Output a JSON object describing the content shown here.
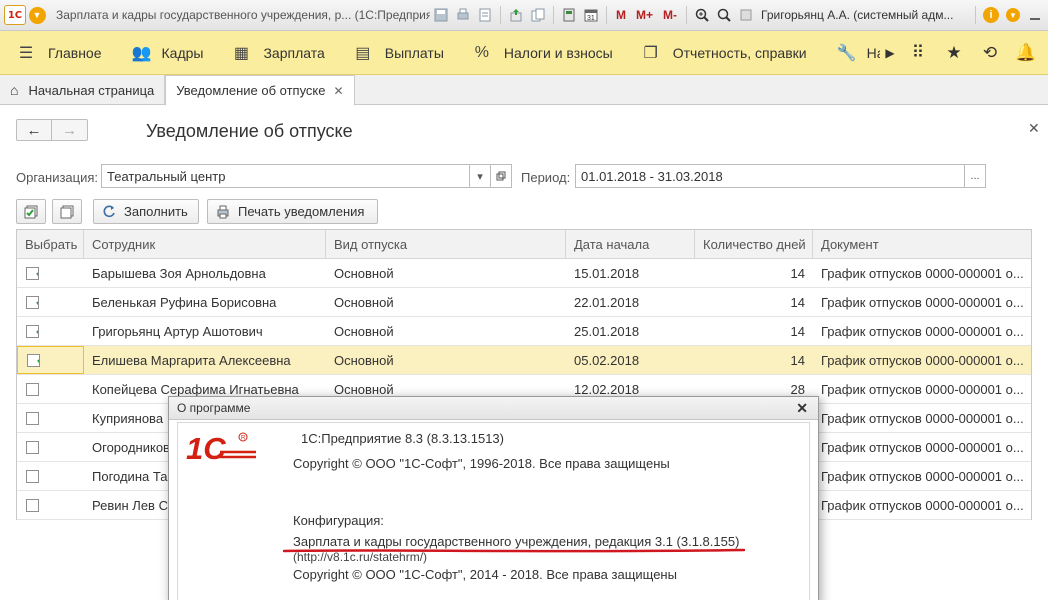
{
  "titlebar": {
    "app_logo": "1С",
    "window_title": "Зарплата и кадры государственного учреждения, р... (1С:Предприятие)",
    "mplus": "M",
    "mplus2": "M+",
    "mminus": "M-",
    "user": "Григорьянц А.А. (системный адм...",
    "icons": [
      "save-icon",
      "print-icon",
      "preview-icon",
      "link-icon",
      "calculator-icon",
      "calendar-icon",
      "zoom-icon",
      "search-icon",
      "info-icon",
      "minimize-icon"
    ]
  },
  "sections": [
    {
      "label": "Главное",
      "icon": "menu-icon"
    },
    {
      "label": "Кадры",
      "icon": "people-icon"
    },
    {
      "label": "Зарплата",
      "icon": "calculator-icon"
    },
    {
      "label": "Выплаты",
      "icon": "wallet-icon"
    },
    {
      "label": "Налоги и взносы",
      "icon": "percent-icon"
    },
    {
      "label": "Отчетность, справки",
      "icon": "report-icon"
    },
    {
      "label": "Настрой",
      "icon": "wrench-icon"
    }
  ],
  "tabs": [
    {
      "label": "Начальная страница"
    },
    {
      "label": "Уведомление об отпуске"
    }
  ],
  "form": {
    "title": "Уведомление об отпуске",
    "org_label": "Организация:",
    "org_value": "Театральный центр",
    "period_label": "Период:",
    "period_value": "01.01.2018 - 31.03.2018",
    "period_btn": "...",
    "fill_btn": "Заполнить",
    "print_btn": "Печать уведомления"
  },
  "table": {
    "columns": [
      "Выбрать",
      "Сотрудник",
      "Вид отпуска",
      "Дата начала",
      "Количество дней",
      "Документ"
    ],
    "rows": [
      {
        "checked": true,
        "employee": "Барышева Зоя Арнольдовна",
        "type": "Основной",
        "start": "15.01.2018",
        "days": "14",
        "doc": "График отпусков 0000-000001 о..."
      },
      {
        "checked": true,
        "employee": "Беленькая Руфина Борисовна",
        "type": "Основной",
        "start": "22.01.2018",
        "days": "14",
        "doc": "График отпусков 0000-000001 о..."
      },
      {
        "checked": true,
        "employee": "Григорьянц Артур Ашотович",
        "type": "Основной",
        "start": "25.01.2018",
        "days": "14",
        "doc": "График отпусков 0000-000001 о..."
      },
      {
        "checked": true,
        "employee": "Елишева Маргарита Алексеевна",
        "type": "Основной",
        "start": "05.02.2018",
        "days": "14",
        "doc": "График отпусков 0000-000001 о..."
      },
      {
        "checked": false,
        "employee": "Копейцева Серафима Игнатьевна",
        "type": "Основной",
        "start": "12.02.2018",
        "days": "28",
        "doc": "График отпусков 0000-000001 о..."
      },
      {
        "checked": false,
        "employee": "Куприянова",
        "type": "",
        "start": "",
        "days": "",
        "doc": "График отпусков 0000-000001 о..."
      },
      {
        "checked": false,
        "employee": "Огородников",
        "type": "",
        "start": "",
        "days": "",
        "doc": "График отпусков 0000-000001 о..."
      },
      {
        "checked": false,
        "employee": "Погодина Та",
        "type": "",
        "start": "",
        "days": "",
        "doc": "График отпусков 0000-000001 о..."
      },
      {
        "checked": false,
        "employee": "Ревин Лев С",
        "type": "",
        "start": "",
        "days": "",
        "doc": "График отпусков 0000-000001 о..."
      }
    ]
  },
  "about": {
    "title": "О программе",
    "logo_text": "1С",
    "platform": "1С:Предприятие 8.3 (8.3.13.1513)",
    "copyright1": "Copyright © ООО \"1С-Софт\", 1996-2018. Все права защищены",
    "config_label": "Конфигурация:",
    "config_name": "Зарплата и кадры государственного учреждения, редакция 3.1 (3.1.8.155)",
    "config_url": "(http://v8.1c.ru/statehrm/)",
    "copyright2": "Copyright © ООО \"1С-Софт\", 2014 - 2018. Все права защищены"
  },
  "colors": {
    "accent_bar": "#fbed9e",
    "selected_row": "#fbf0c0",
    "underline": "#d0161e",
    "logo_red": "#d32010"
  }
}
